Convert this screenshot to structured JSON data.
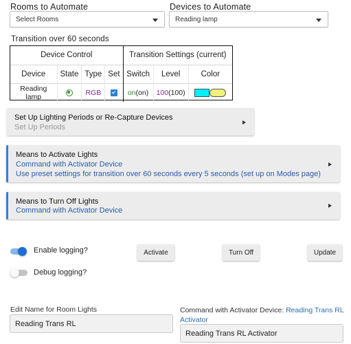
{
  "rooms": {
    "label": "Rooms to Automate",
    "value": "Select Rooms"
  },
  "devices": {
    "label": "Devices to Automate",
    "value": "Reading lamp"
  },
  "transition": {
    "title": "Transition over 60 seconds",
    "group_headers": [
      "Device Control",
      "Transition Settings (current)"
    ],
    "columns": [
      "Device",
      "State",
      "Type",
      "Set",
      "Switch",
      "Level",
      "Color"
    ],
    "rows": [
      {
        "device": "Reading lamp",
        "state_icon": "radio-on-icon",
        "type": "RGB",
        "set_icon": "checkbox-checked-icon",
        "switch_value": "on",
        "switch_current": "(on)",
        "level_value": "100",
        "level_current": "(100)",
        "color_target": "#00f0ff",
        "color_current": "#f0f07a"
      }
    ]
  },
  "cards": [
    {
      "title": "Set Up Lighting Periods or Re-Capture Devices",
      "lines": [
        "Set Up Periods"
      ]
    },
    {
      "title": "Means to Activate Lights",
      "lines": [
        "Command with Activator Device",
        "Use preset settings for transition over 60 seconds every 5 seconds (set up on Modes page)"
      ]
    },
    {
      "title": "Means to Turn Off Lights",
      "lines": [
        "Command with Activator Device"
      ]
    }
  ],
  "toggles": [
    {
      "label": "Enable logging?",
      "on": true
    },
    {
      "label": "Debug logging?",
      "on": false
    }
  ],
  "buttons": {
    "activate": "Activate",
    "turn_off": "Turn Off",
    "update": "Update"
  },
  "name_field": {
    "label": "Edit Name for Room Lights",
    "value": "Reading Trans RL"
  },
  "activator_field": {
    "label": "Command with Activator Device: ",
    "link": "Reading Trans RL Activator",
    "value": "Reading Trans RL Activator"
  },
  "colors": {
    "accent": "#2f7fd9",
    "link": "#2e5ca8",
    "green": "#2e8b2e",
    "purple": "#8a2a9a"
  }
}
